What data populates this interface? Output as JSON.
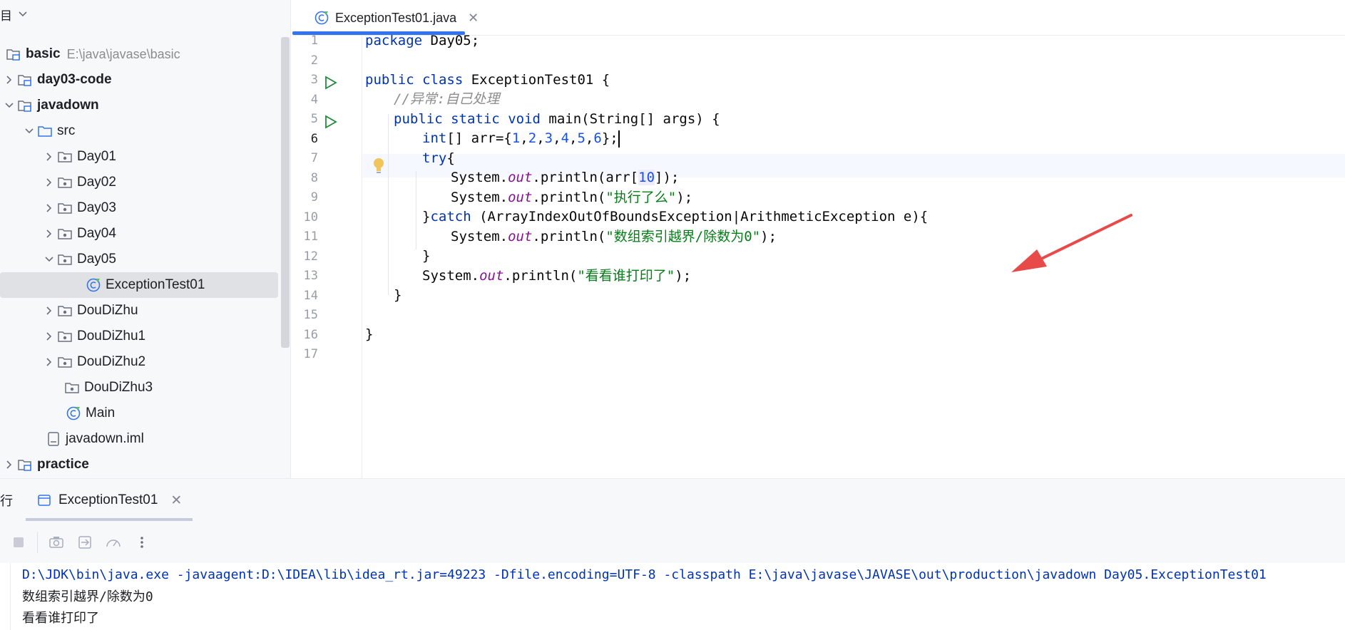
{
  "project": {
    "header_label": "目",
    "items": [
      {
        "name": "basic",
        "path": "E:\\java\\javase\\basic"
      },
      {
        "name": "day03-code"
      },
      {
        "name": "javadown"
      },
      {
        "name": "src"
      },
      {
        "name": "Day01"
      },
      {
        "name": "Day02"
      },
      {
        "name": "Day03"
      },
      {
        "name": "Day04"
      },
      {
        "name": "Day05"
      },
      {
        "name": "ExceptionTest01"
      },
      {
        "name": "DouDiZhu"
      },
      {
        "name": "DouDiZhu1"
      },
      {
        "name": "DouDiZhu2"
      },
      {
        "name": "DouDiZhu3"
      },
      {
        "name": "Main"
      },
      {
        "name": "javadown.iml"
      },
      {
        "name": "practice"
      }
    ]
  },
  "editor": {
    "tab_label": "ExceptionTest01.java",
    "close_glyph": "✕",
    "line_numbers": [
      "1",
      "2",
      "3",
      "4",
      "5",
      "6",
      "7",
      "8",
      "9",
      "10",
      "11",
      "12",
      "13",
      "14",
      "15",
      "16",
      "17"
    ],
    "code": {
      "l1_kw": "package",
      "l1_rest": " Day05;",
      "l3_kw1": "public",
      "l3_kw2": "class",
      "l3_rest": " ExceptionTest01 {",
      "l4_comment": "//异常:自己处理",
      "l5_kw1": "public",
      "l5_kw2": "static",
      "l5_kw3": "void",
      "l5_rest": " main(String[] args) {",
      "l6_kw": "int",
      "l6_a": "[] arr={",
      "l6_n1": "1",
      "l6_n2": "2",
      "l6_n3": "3",
      "l6_n4": "4",
      "l6_n5": "5",
      "l6_n6": "6",
      "comma": ",",
      "l6_end": "};",
      "l7_kw": "try",
      "l7_rest": "{",
      "sys": "System.",
      "out": "out",
      "println_open": ".println(",
      "l8_a": "arr[",
      "l8_num": "10",
      "l8_end": "]);",
      "l9_str": "\"执行了么\"",
      "close_paren": ");",
      "l10_a": "}",
      "l10_kw": "catch",
      "l10_rest": " (ArrayIndexOutOfBoundsException|ArithmeticException e){",
      "l11_str": "\"数组索引越界/除数为0\"",
      "l12": "}",
      "l13_str": "\"看看谁打印了\"",
      "l14": "}",
      "l16": "}"
    }
  },
  "run": {
    "title": "行",
    "tab_label": "ExceptionTest01",
    "close_glyph": "✕",
    "console": [
      "D:\\JDK\\bin\\java.exe -javaagent:D:\\IDEA\\lib\\idea_rt.jar=49223 -Dfile.encoding=UTF-8 -classpath E:\\java\\javase\\JAVASE\\out\\production\\javadown Day05.ExceptionTest01",
      "数组索引越界/除数为0",
      "看看谁打印了"
    ]
  },
  "colors": {
    "keyword": "#0033b3",
    "string": "#067d17",
    "number": "#1750eb",
    "field": "#871094",
    "comment": "#8c8c8c",
    "accent": "#3574f0",
    "annotation_arrow": "#e84a4a"
  },
  "icons": [
    "chevron-down-icon",
    "chevron-right-icon",
    "module-icon",
    "folder-icon",
    "package-icon",
    "java-class-icon",
    "iml-file-icon",
    "run-gutter-icon",
    "bulb-icon",
    "stop-icon",
    "camera-icon",
    "exit-icon",
    "gauge-icon",
    "more-icon",
    "console-tab-icon"
  ]
}
